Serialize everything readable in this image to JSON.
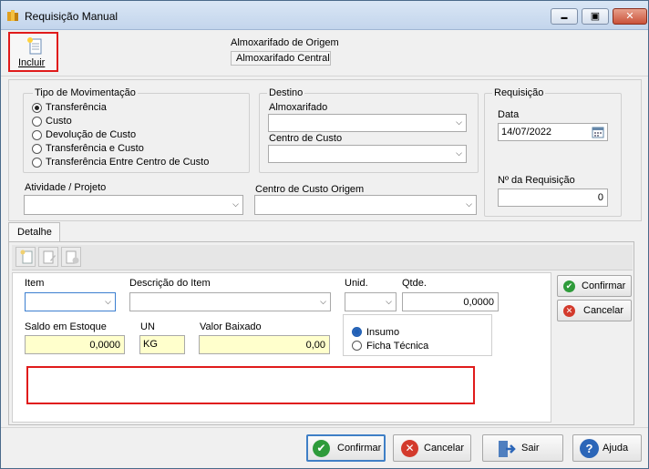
{
  "window": {
    "title": "Requisição Manual",
    "minimize": "▬",
    "maximize": "▣",
    "close": "✕"
  },
  "toolbar": {
    "incluir": "Incluir"
  },
  "almox_origem": {
    "label": "Almoxarifado de Origem",
    "value": "Almoxarifado Central"
  },
  "tipo_mov": {
    "legend": "Tipo de Movimentação",
    "options": [
      "Transferência",
      "Custo",
      "Devolução de Custo",
      "Transferência e Custo",
      "Transferência Entre Centro de Custo"
    ],
    "selected": "Transferência"
  },
  "destino": {
    "legend": "Destino",
    "almox_label": "Almoxarifado",
    "almox_value": "",
    "cc_label": "Centro de Custo",
    "cc_value": ""
  },
  "requisicao": {
    "legend": "Requisição",
    "data_label": "Data",
    "data_value": "14/07/2022",
    "num_label": "Nº  da Requisição",
    "num_value": "0"
  },
  "atividade": {
    "label": "Atividade / Projeto",
    "value": ""
  },
  "cc_origem": {
    "label": "Centro de Custo Origem",
    "value": ""
  },
  "tabs": {
    "detalhe": "Detalhe"
  },
  "detalhe": {
    "item_label": "Item",
    "item_value": "",
    "desc_label": "Descrição do Item",
    "desc_value": "",
    "unid_label": "Unid.",
    "unid_value": "",
    "qtde_label": "Qtde.",
    "qtde_value": "0,0000",
    "saldo_label": "Saldo em Estoque",
    "saldo_value": "0,0000",
    "un_label": "UN",
    "un_value": "KG",
    "valor_label": "Valor Baixado",
    "valor_value": "0,00",
    "insumo_label": "Insumo",
    "ficha_label": "Ficha Técnica",
    "tipo_selected": "Insumo"
  },
  "side_buttons": {
    "confirmar": "Confirmar",
    "cancelar": "Cancelar"
  },
  "footer": {
    "confirmar": "Confirmar",
    "cancelar": "Cancelar",
    "sair": "Sair",
    "ajuda": "Ajuda"
  }
}
